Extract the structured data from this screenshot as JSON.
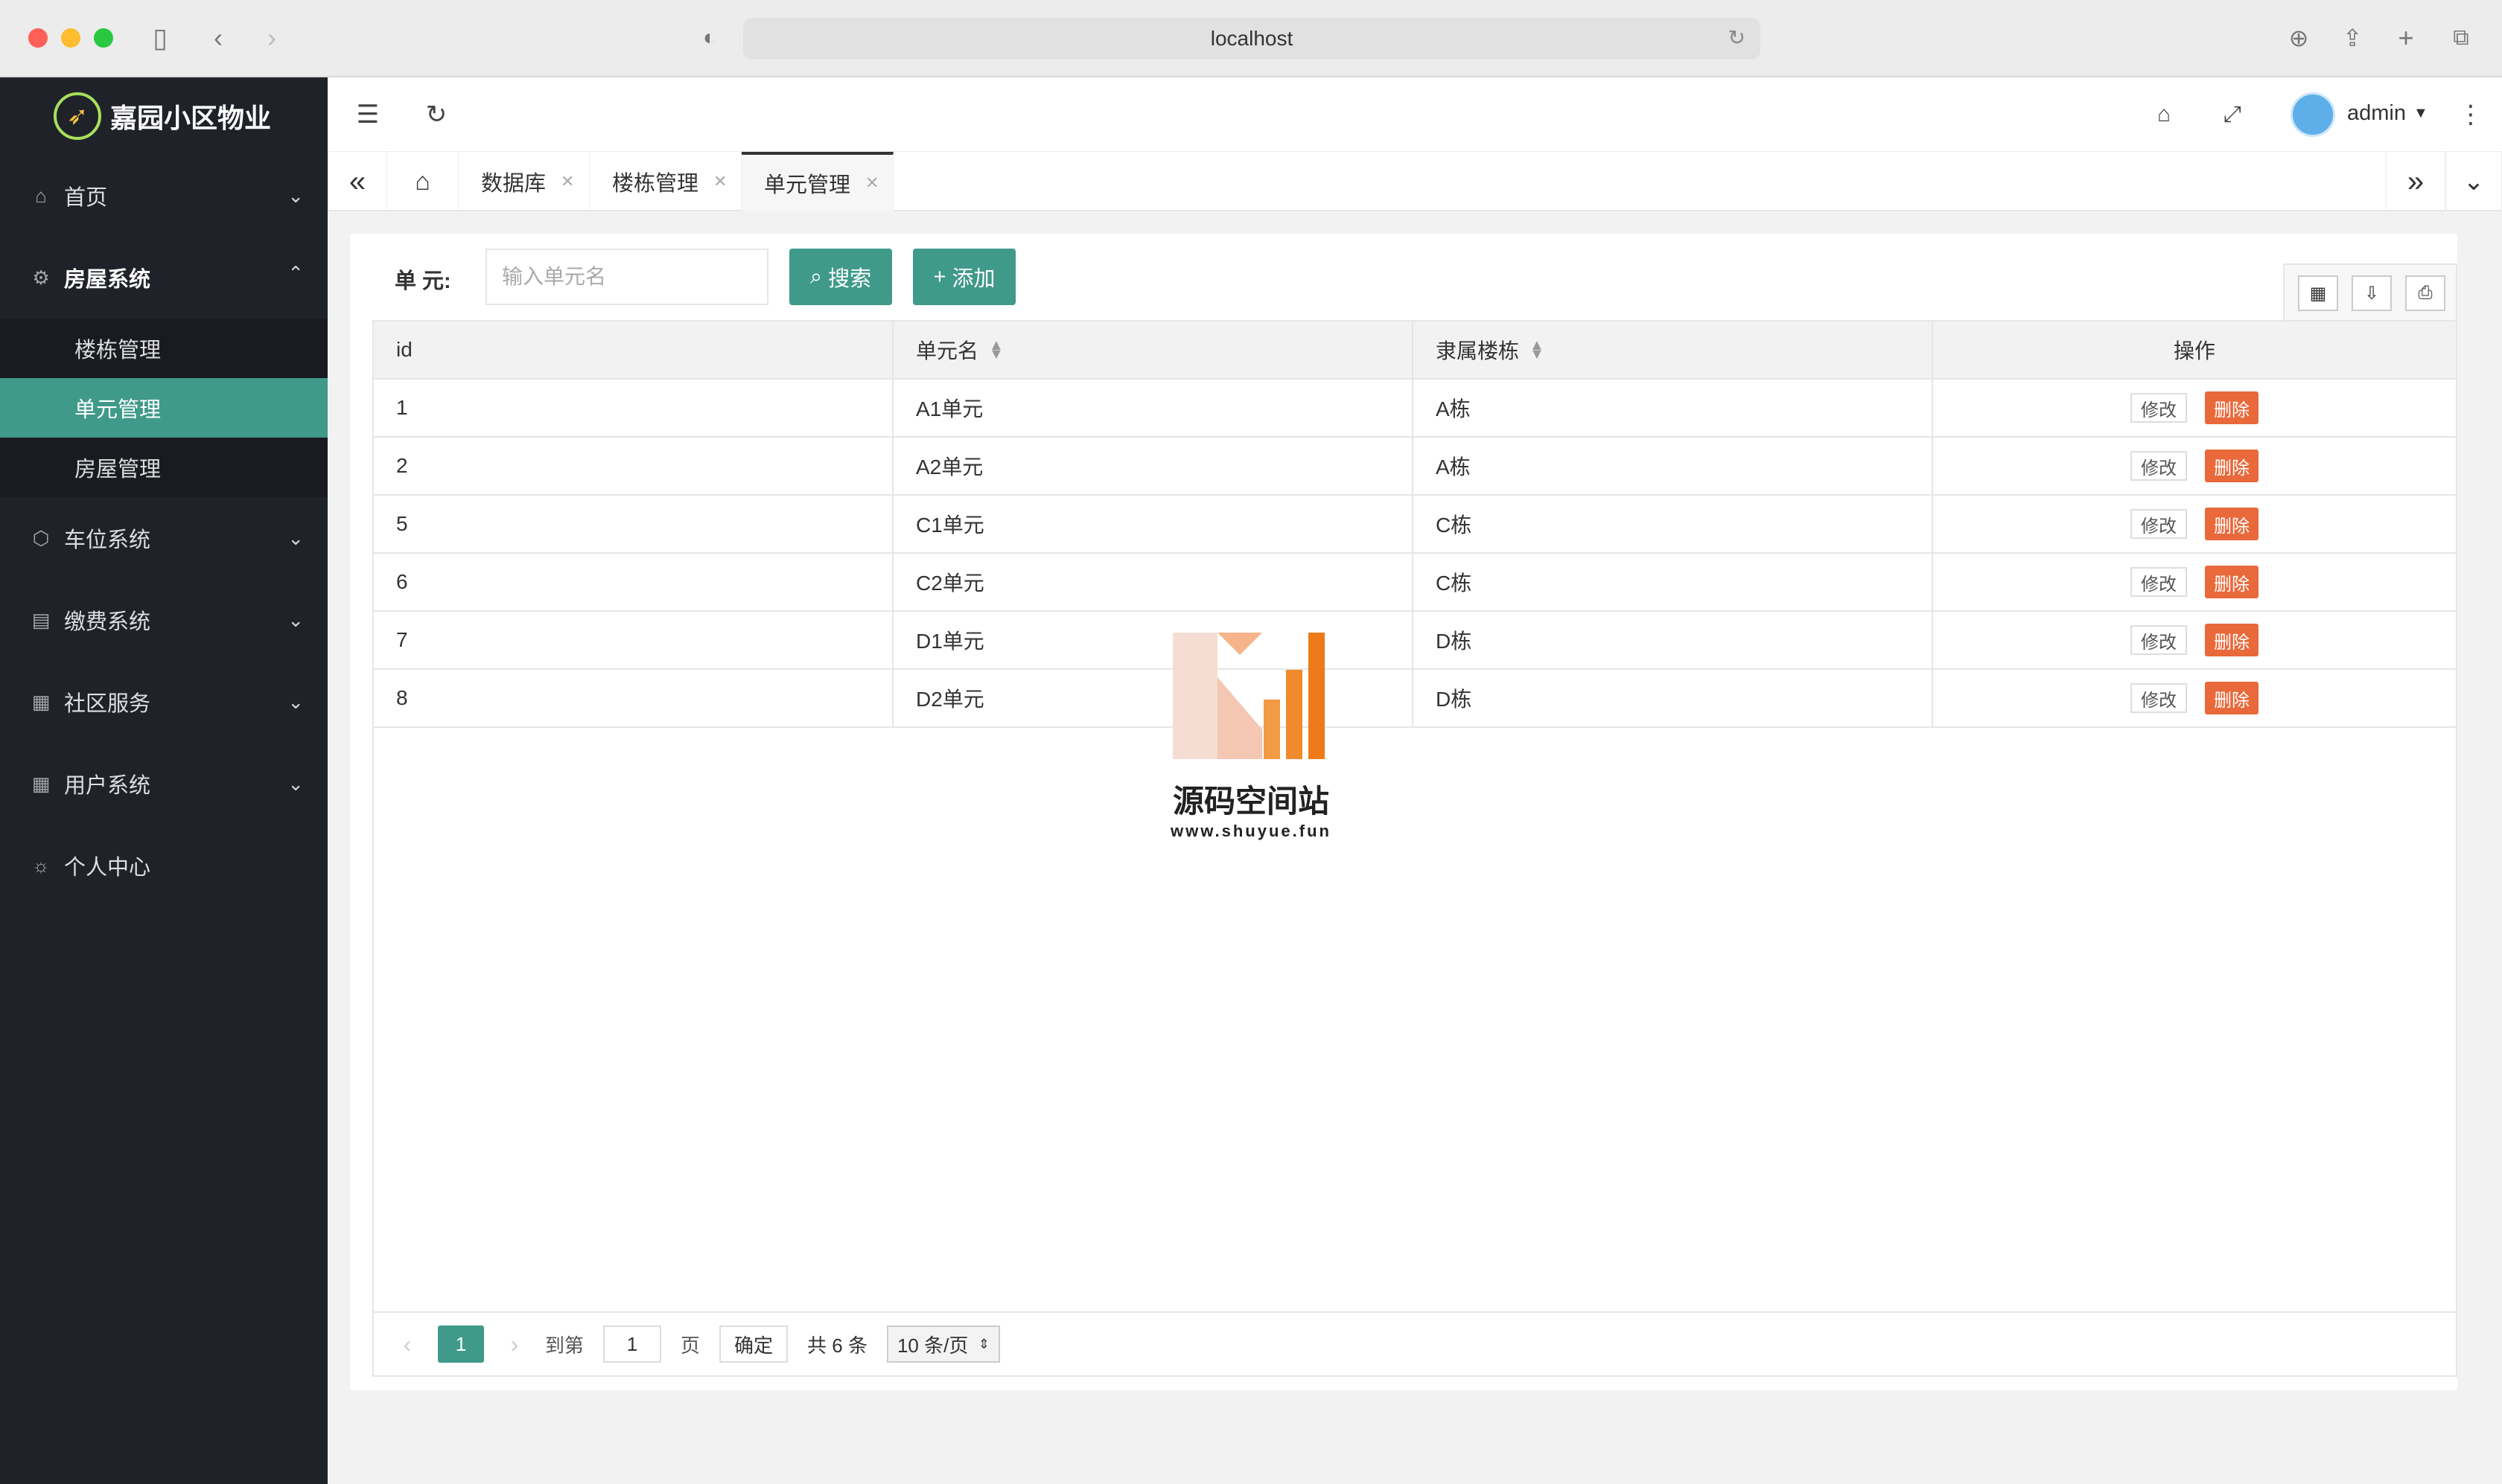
{
  "browser": {
    "url": "localhost"
  },
  "app": {
    "name": "嘉园小区物业"
  },
  "sidebar": {
    "items": [
      {
        "label": "首页",
        "icon": "home-icon"
      },
      {
        "label": "房屋系统",
        "icon": "gear-icon"
      },
      {
        "label": "车位系统",
        "icon": "cube-icon"
      },
      {
        "label": "缴费系统",
        "icon": "bill-icon"
      },
      {
        "label": "社区服务",
        "icon": "apps-icon"
      },
      {
        "label": "用户系统",
        "icon": "apps-icon"
      },
      {
        "label": "个人中心",
        "icon": "sun-icon"
      }
    ],
    "sub_items": [
      {
        "label": "楼栋管理"
      },
      {
        "label": "单元管理"
      },
      {
        "label": "房屋管理"
      }
    ]
  },
  "header": {
    "user": "admin"
  },
  "tabs": [
    {
      "label": "数据库"
    },
    {
      "label": "楼栋管理"
    },
    {
      "label": "单元管理"
    }
  ],
  "search": {
    "label": "单 元:",
    "placeholder": "输入单元名",
    "search_button": "搜索",
    "add_button": "添加"
  },
  "table": {
    "columns": [
      "id",
      "单元名",
      "隶属楼栋",
      "操作"
    ],
    "rows": [
      {
        "id": "1",
        "name": "A1单元",
        "building": "A栋"
      },
      {
        "id": "2",
        "name": "A2单元",
        "building": "A栋"
      },
      {
        "id": "5",
        "name": "C1单元",
        "building": "C栋"
      },
      {
        "id": "6",
        "name": "C2单元",
        "building": "C栋"
      },
      {
        "id": "7",
        "name": "D1单元",
        "building": "D栋"
      },
      {
        "id": "8",
        "name": "D2单元",
        "building": "D栋"
      }
    ],
    "edit_label": "修改",
    "delete_label": "删除"
  },
  "pager": {
    "current": "1",
    "goto_label": "到第",
    "page_value": "1",
    "page_suffix": "页",
    "confirm": "确定",
    "total": "共 6 条",
    "page_size": "10 条/页"
  },
  "watermark": {
    "name": "源码空间站",
    "site": "www.shuyue.fun"
  },
  "colors": {
    "accent": "#3f9a89",
    "sidebar": "#20222a",
    "danger": "#e9693b"
  }
}
